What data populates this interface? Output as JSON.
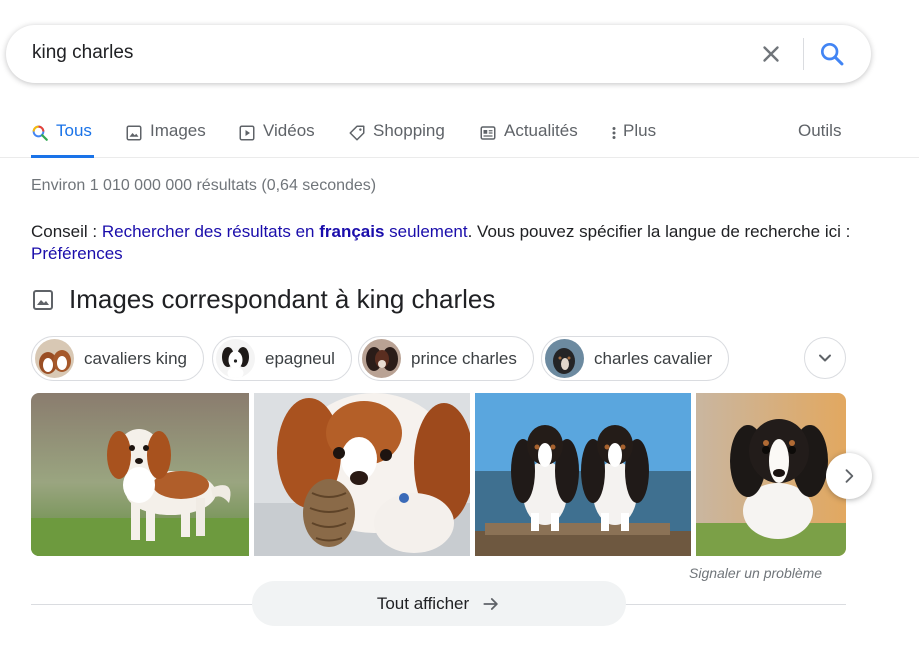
{
  "search": {
    "query": "king charles"
  },
  "tabs": [
    {
      "label": "Tous",
      "icon": "google-search-icon",
      "active": true
    },
    {
      "label": "Images",
      "icon": "image-icon"
    },
    {
      "label": "Vidéos",
      "icon": "play-icon"
    },
    {
      "label": "Shopping",
      "icon": "tag-icon"
    },
    {
      "label": "Actualités",
      "icon": "news-icon"
    },
    {
      "label": "Plus",
      "icon": "more-vert-icon"
    }
  ],
  "tools_label": "Outils",
  "stats": "Environ 1 010 000 000 résultats (0,64 secondes)",
  "conseil": {
    "prefix": "Conseil : ",
    "link_part1": "Rechercher des résultats en ",
    "link_bold": "français",
    "link_part2": " seulement",
    "middle": ". Vous pouvez spécifier la langue de recherche ici : ",
    "pref_link": "Préférences"
  },
  "images_heading": "Images correspondant à king charles",
  "chips": [
    {
      "label": "cavaliers king"
    },
    {
      "label": "epagneul"
    },
    {
      "label": "prince charles"
    },
    {
      "label": "charles cavalier"
    }
  ],
  "report_problem": "Signaler un problème",
  "show_all": "Tout afficher",
  "colors": {
    "accent": "#1a73e8",
    "link": "#1a0dab",
    "muted": "#70757a"
  }
}
